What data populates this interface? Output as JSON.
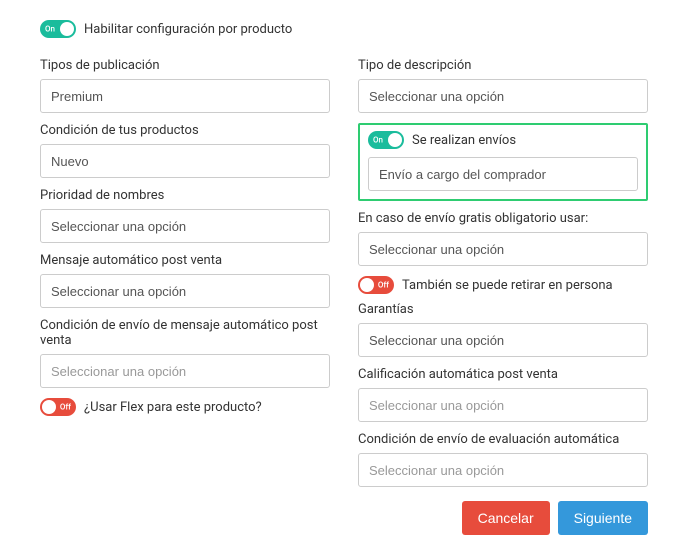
{
  "toggle_on_label": "On",
  "toggle_off_label": "Off",
  "enable_product_config": "Habilitar configuración por producto",
  "left": {
    "publication_types": {
      "label": "Tipos de publicación",
      "value": "Premium"
    },
    "product_condition": {
      "label": "Condición de tus productos",
      "value": "Nuevo"
    },
    "name_priority": {
      "label": "Prioridad de nombres",
      "value": "Seleccionar una opción"
    },
    "auto_message": {
      "label": "Mensaje automático post venta",
      "value": "Seleccionar una opción"
    },
    "auto_message_condition": {
      "label": "Condición de envío de mensaje automático post venta",
      "placeholder": "Seleccionar una opción"
    },
    "use_flex": {
      "label": "¿Usar Flex para este producto?"
    }
  },
  "right": {
    "description_type": {
      "label": "Tipo de descripción",
      "value": "Seleccionar una opción"
    },
    "shipping_toggle": {
      "label": "Se realizan envíos"
    },
    "shipping_value": "Envío a cargo del comprador",
    "free_shipping_fallback": {
      "label": "En caso de envío gratis obligatorio usar:",
      "value": "Seleccionar una opción"
    },
    "pickup_toggle": {
      "label": "También se puede retirar en persona"
    },
    "warranties": {
      "label": "Garantías",
      "value": "Seleccionar una opción"
    },
    "auto_rating": {
      "label": "Calificación automática post venta",
      "placeholder": "Seleccionar una opción"
    },
    "auto_eval_condition": {
      "label": "Condición de envío de evaluación automática",
      "placeholder": "Seleccionar una opción"
    }
  },
  "buttons": {
    "cancel": "Cancelar",
    "next": "Siguiente"
  }
}
